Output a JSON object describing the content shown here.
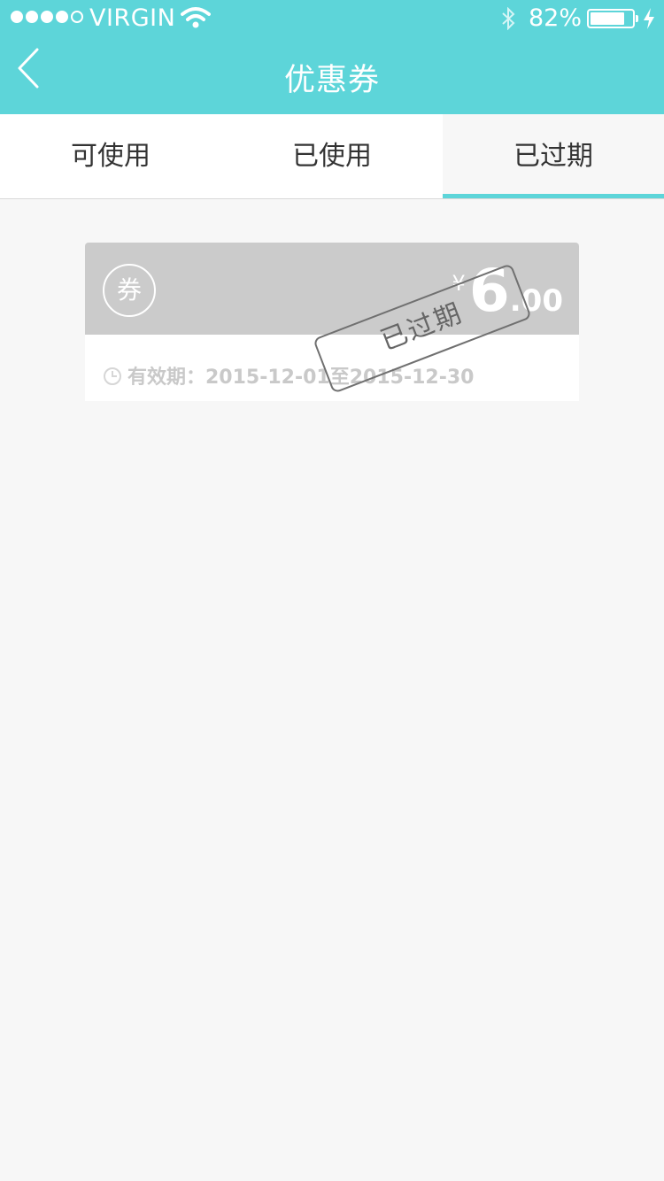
{
  "status_bar": {
    "carrier": "VIRGIN",
    "battery_percent": "82%",
    "battery_level": 0.82,
    "signal_bars": 4
  },
  "nav": {
    "title": "优惠券",
    "back_icon": "chevron-left-icon"
  },
  "tabs": [
    {
      "label": "可使用",
      "active": false
    },
    {
      "label": "已使用",
      "active": false
    },
    {
      "label": "已过期",
      "active": true
    }
  ],
  "coupon": {
    "badge": "券",
    "currency": "¥",
    "amount_int": "6",
    "amount_dec": ".00",
    "validity": "有效期：2015-12-01至2015-12-30",
    "stamp": "已过期"
  },
  "colors": {
    "accent": "#5dd5d9",
    "coupon_expired": "#cbcbcb",
    "background": "#f7f7f7"
  }
}
